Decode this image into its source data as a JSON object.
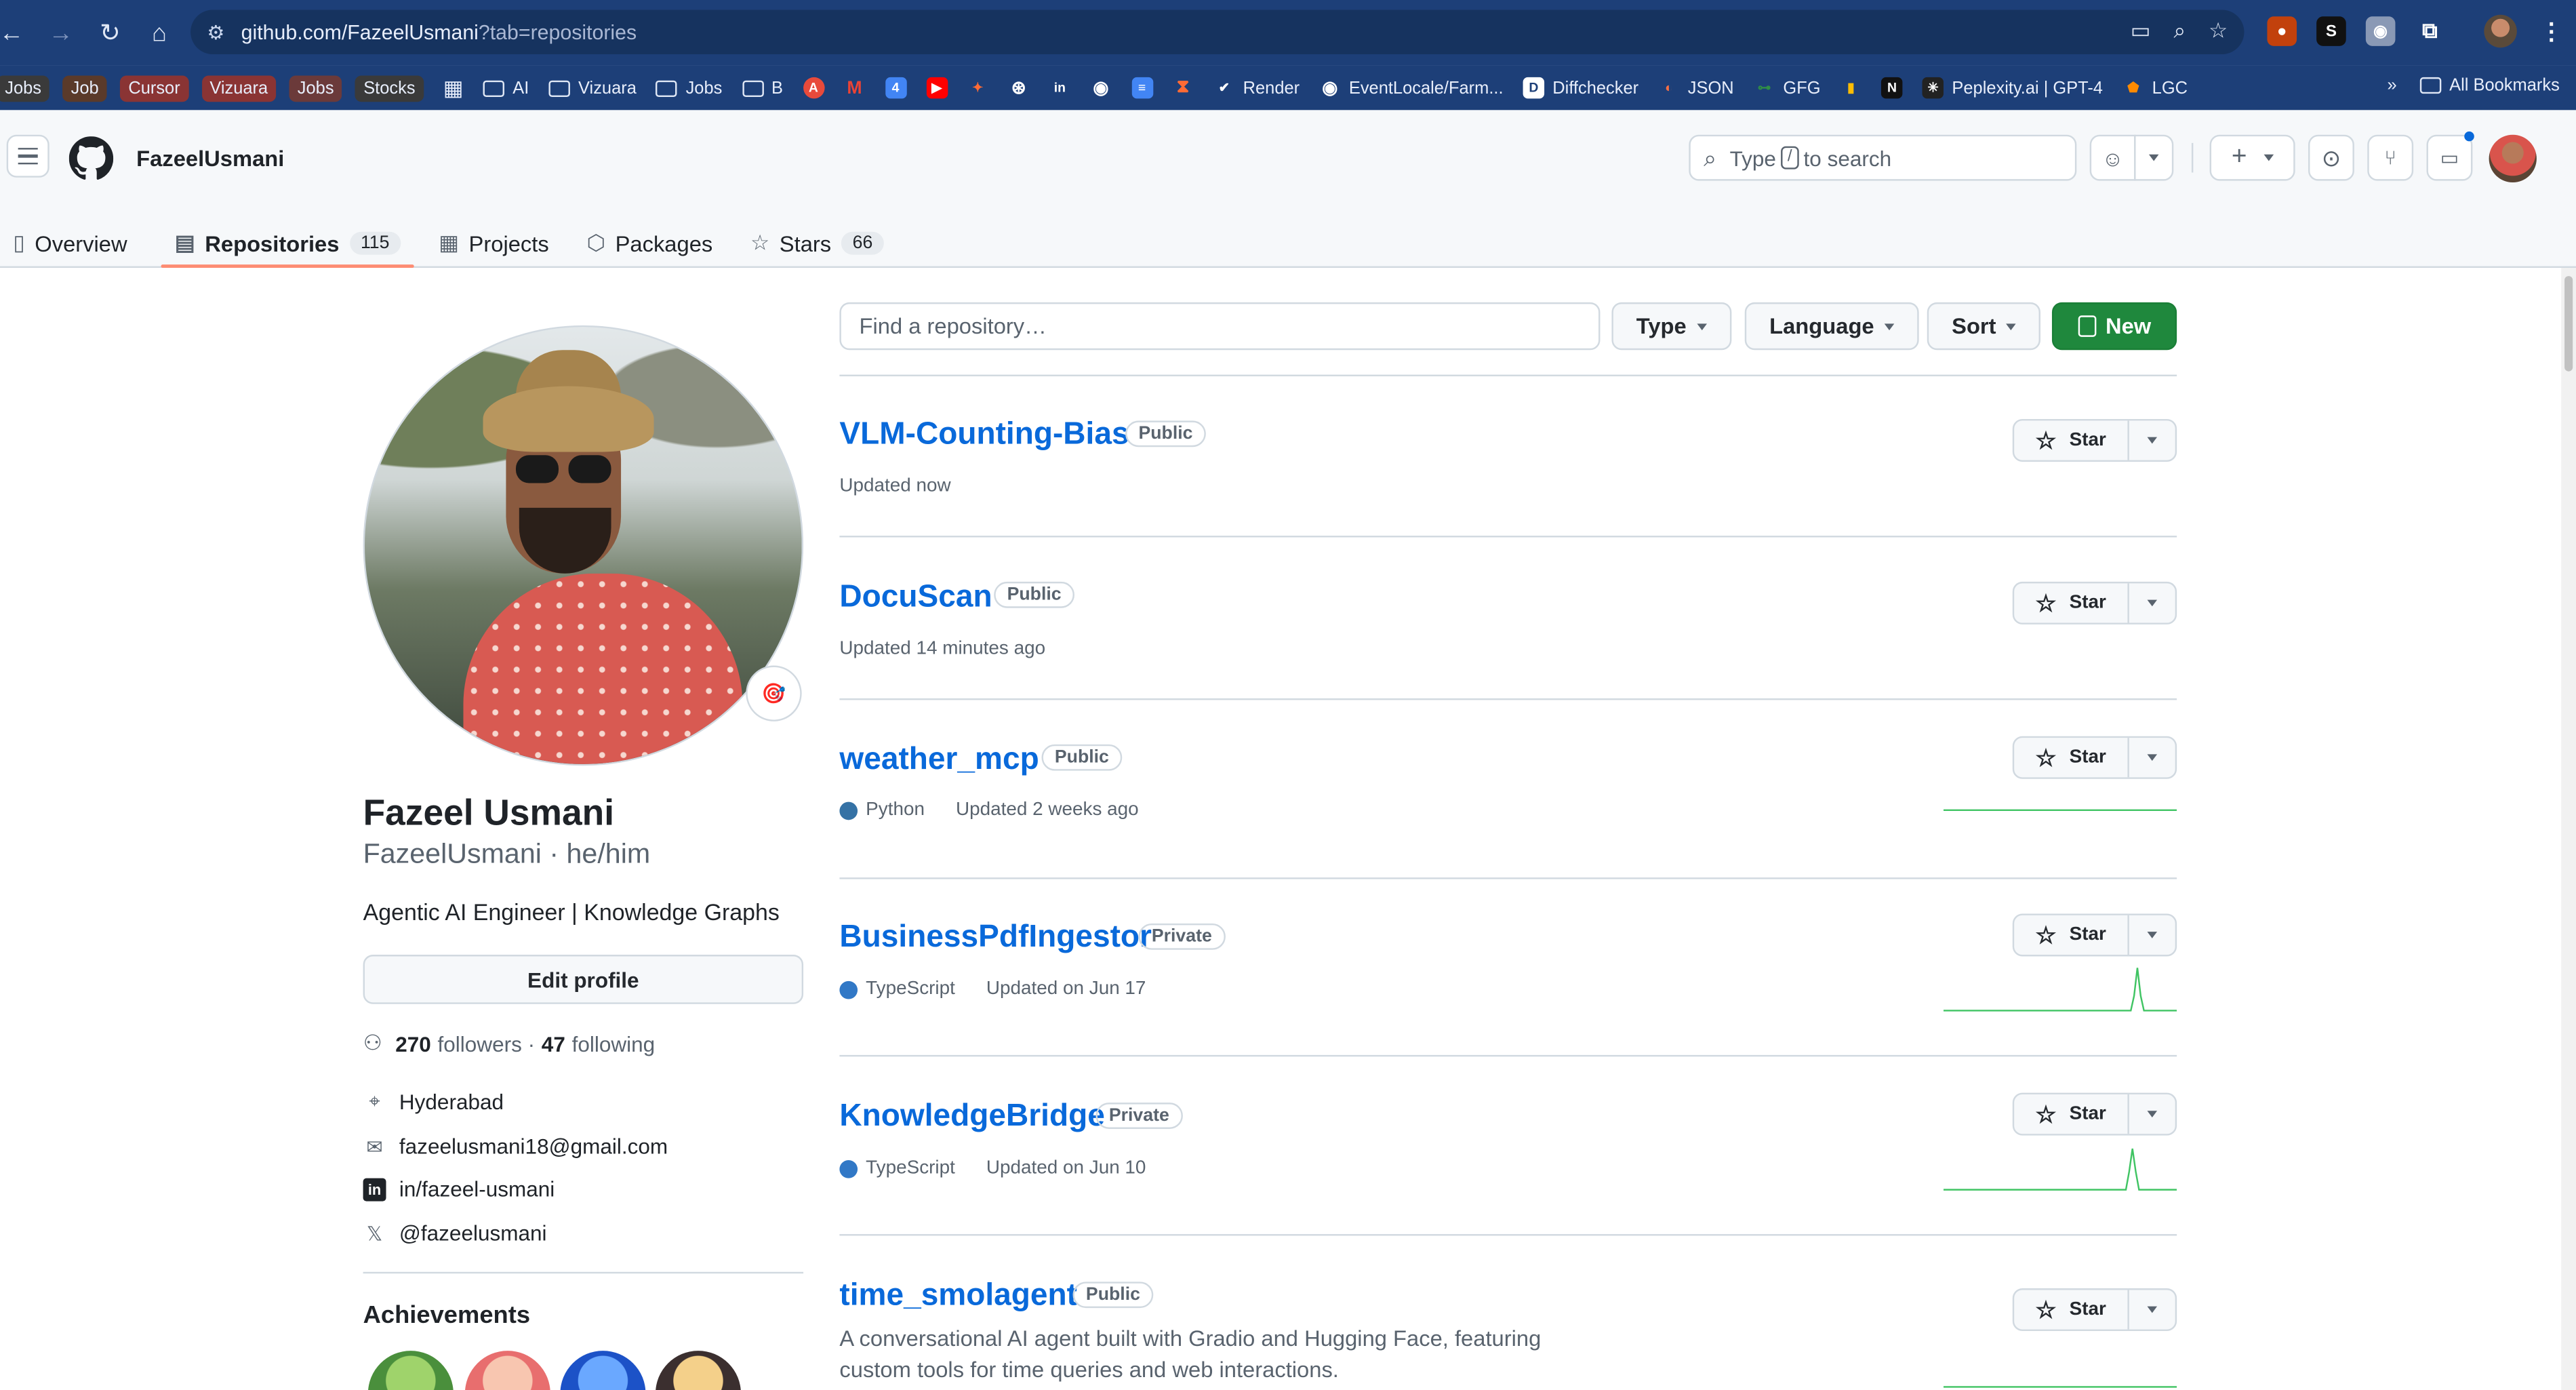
{
  "browser": {
    "url_host": "github.com/FazeelUsmani",
    "url_rest": "?tab=repositories",
    "bookmarks": {
      "chips": [
        "Jobs",
        "Job",
        "Cursor",
        "Vizuara",
        "Jobs",
        "Stocks"
      ],
      "folders": [
        "AI",
        "Vizuara",
        "Jobs",
        "B"
      ],
      "named": [
        "Render",
        "EventLocale/Farm...",
        "Diffchecker",
        "JSON",
        "GFG",
        "Peplexity.ai | GPT-4",
        "LGC"
      ],
      "all_bookmarks": "All Bookmarks",
      "overflow": "»"
    }
  },
  "header": {
    "username": "FazeelUsmani",
    "search_prefix": "Type",
    "search_key": "/",
    "search_suffix": "to search"
  },
  "tabs": [
    {
      "label": "Overview",
      "icon": "book-icon"
    },
    {
      "label": "Repositories",
      "icon": "repo-icon",
      "count": "115"
    },
    {
      "label": "Projects",
      "icon": "table-icon"
    },
    {
      "label": "Packages",
      "icon": "package-icon"
    },
    {
      "label": "Stars",
      "icon": "star-icon",
      "count": "66"
    }
  ],
  "profile": {
    "name": "Fazeel Usmani",
    "login_line": "FazeelUsmani · he/him",
    "bio": "Agentic AI Engineer | Knowledge Graphs",
    "edit_label": "Edit profile",
    "followers_count": "270",
    "followers_label": "followers ·",
    "following_count": "47",
    "following_label": "following",
    "location": "Hyderabad",
    "email": "fazeelusmani18@gmail.com",
    "linkedin": "in/fazeel-usmani",
    "x_handle": "@fazeelusmani",
    "achievements_title": "Achievements"
  },
  "filters": {
    "find_placeholder": "Find a repository…",
    "type_label": "Type",
    "language_label": "Language",
    "sort_label": "Sort",
    "new_label": "New"
  },
  "repos": [
    {
      "name": "VLM-Counting-Bias",
      "visibility": "Public",
      "language": "",
      "updated": "Updated now",
      "star_label": "Star"
    },
    {
      "name": "DocuScan",
      "visibility": "Public",
      "language": "",
      "updated": "Updated 14 minutes ago",
      "star_label": "Star"
    },
    {
      "name": "weather_mcp",
      "visibility": "Public",
      "language": "Python",
      "updated": "Updated 2 weeks ago",
      "star_label": "Star"
    },
    {
      "name": "BusinessPdfIngestor",
      "visibility": "Private",
      "language": "TypeScript",
      "updated": "Updated on Jun 17",
      "star_label": "Star"
    },
    {
      "name": "KnowledgeBridge",
      "visibility": "Private",
      "language": "TypeScript",
      "updated": "Updated on Jun 10",
      "star_label": "Star"
    },
    {
      "name": "time_smolagent",
      "visibility": "Public",
      "language": "",
      "description_line1": "A conversational AI agent built with Gradio and Hugging Face, featuring",
      "description_line2": "custom tools for time queries and web interactions.",
      "star_label": "Star"
    }
  ],
  "colors": {
    "link": "#0969da",
    "python": "#3572A5",
    "typescript": "#3178c6",
    "new_button": "#1f883d",
    "tab_underline": "#fd8c73",
    "browser_chrome": "#1d3f78"
  }
}
